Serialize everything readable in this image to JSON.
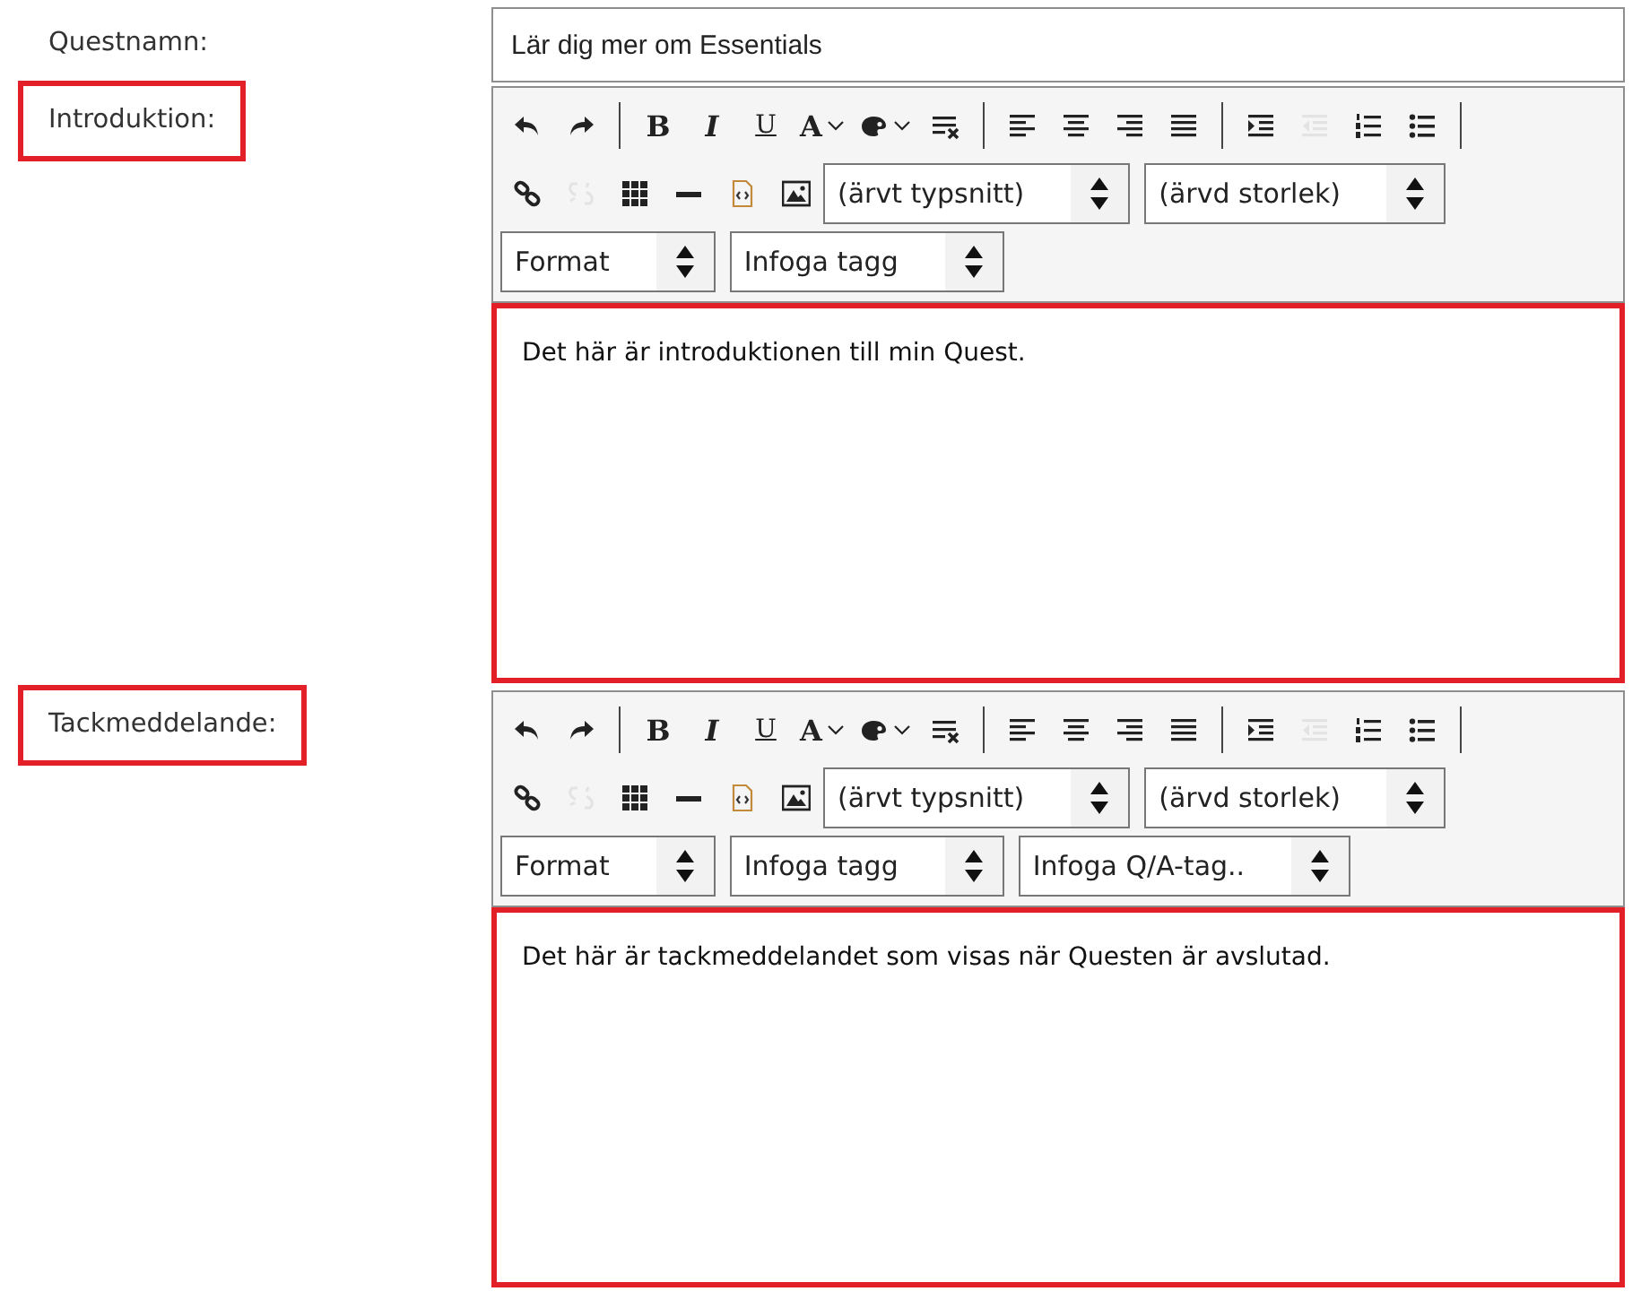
{
  "fields": [
    {
      "kind": "text",
      "label": "Questnamn:",
      "highlighted": false,
      "value": "Lär dig mer om Essentials"
    },
    {
      "kind": "editor",
      "label": "Introduktion:",
      "highlighted": true,
      "content_highlighted": true,
      "content": "Det här är introduktionen till min Quest.",
      "toolbar": [
        [
          {
            "kind": "undo",
            "disabled": false
          },
          {
            "kind": "redo",
            "disabled": false
          },
          {
            "kind": "separator"
          },
          {
            "kind": "bold",
            "label": "B",
            "disabled": false
          },
          {
            "kind": "italic",
            "label": "I",
            "disabled": false
          },
          {
            "kind": "underline",
            "label": "U",
            "disabled": false
          },
          {
            "kind": "textcolor",
            "label": "A",
            "disabled": false
          },
          {
            "kind": "bgcolor",
            "disabled": false
          },
          {
            "kind": "removeformat",
            "disabled": false
          },
          {
            "kind": "separator"
          },
          {
            "kind": "alignleft",
            "disabled": false
          },
          {
            "kind": "aligncenter",
            "disabled": false
          },
          {
            "kind": "alignright",
            "disabled": false
          },
          {
            "kind": "justify",
            "disabled": false
          },
          {
            "kind": "separator"
          },
          {
            "kind": "indent",
            "disabled": false
          },
          {
            "kind": "outdent",
            "disabled": true
          },
          {
            "kind": "numlist",
            "disabled": false
          },
          {
            "kind": "bullist",
            "disabled": false
          },
          {
            "kind": "separator"
          }
        ],
        [
          {
            "kind": "link",
            "disabled": false
          },
          {
            "kind": "unlink",
            "disabled": true
          },
          {
            "kind": "table",
            "disabled": false
          },
          {
            "kind": "hr",
            "disabled": false
          },
          {
            "kind": "source",
            "disabled": false
          },
          {
            "kind": "image",
            "disabled": false
          },
          {
            "kind": "select",
            "value": "(ärvt typsnitt)",
            "disabled": false
          },
          {
            "kind": "select",
            "value": "(ärvd storlek)",
            "disabled": false
          }
        ],
        [
          {
            "kind": "select",
            "value": "Format",
            "disabled": false
          },
          {
            "kind": "select",
            "value": "Infoga tagg",
            "disabled": false
          }
        ]
      ]
    },
    {
      "kind": "editor",
      "label": "Tackmeddelande:",
      "highlighted": true,
      "content_highlighted": true,
      "content": "Det här är tackmeddelandet som visas när Questen är avslutad.",
      "toolbar": [
        [
          {
            "kind": "undo",
            "disabled": false
          },
          {
            "kind": "redo",
            "disabled": false
          },
          {
            "kind": "separator"
          },
          {
            "kind": "bold",
            "label": "B",
            "disabled": false
          },
          {
            "kind": "italic",
            "label": "I",
            "disabled": false
          },
          {
            "kind": "underline",
            "label": "U",
            "disabled": false
          },
          {
            "kind": "textcolor",
            "label": "A",
            "disabled": false
          },
          {
            "kind": "bgcolor",
            "disabled": false
          },
          {
            "kind": "removeformat",
            "disabled": false
          },
          {
            "kind": "separator"
          },
          {
            "kind": "alignleft",
            "disabled": false
          },
          {
            "kind": "aligncenter",
            "disabled": false
          },
          {
            "kind": "alignright",
            "disabled": false
          },
          {
            "kind": "justify",
            "disabled": false
          },
          {
            "kind": "separator"
          },
          {
            "kind": "indent",
            "disabled": false
          },
          {
            "kind": "outdent",
            "disabled": true
          },
          {
            "kind": "numlist",
            "disabled": false
          },
          {
            "kind": "bullist",
            "disabled": false
          },
          {
            "kind": "separator"
          }
        ],
        [
          {
            "kind": "link",
            "disabled": false
          },
          {
            "kind": "unlink",
            "disabled": true
          },
          {
            "kind": "table",
            "disabled": false
          },
          {
            "kind": "hr",
            "disabled": false
          },
          {
            "kind": "source",
            "disabled": false
          },
          {
            "kind": "image",
            "disabled": false
          },
          {
            "kind": "select",
            "value": "(ärvt typsnitt)",
            "disabled": false
          },
          {
            "kind": "select",
            "value": "(ärvd storlek)",
            "disabled": false
          }
        ],
        [
          {
            "kind": "select",
            "value": "Format",
            "disabled": false
          },
          {
            "kind": "select",
            "value": "Infoga tagg",
            "disabled": false
          },
          {
            "kind": "select",
            "value": "Infoga Q/A-tag..",
            "disabled": false
          }
        ]
      ]
    }
  ]
}
